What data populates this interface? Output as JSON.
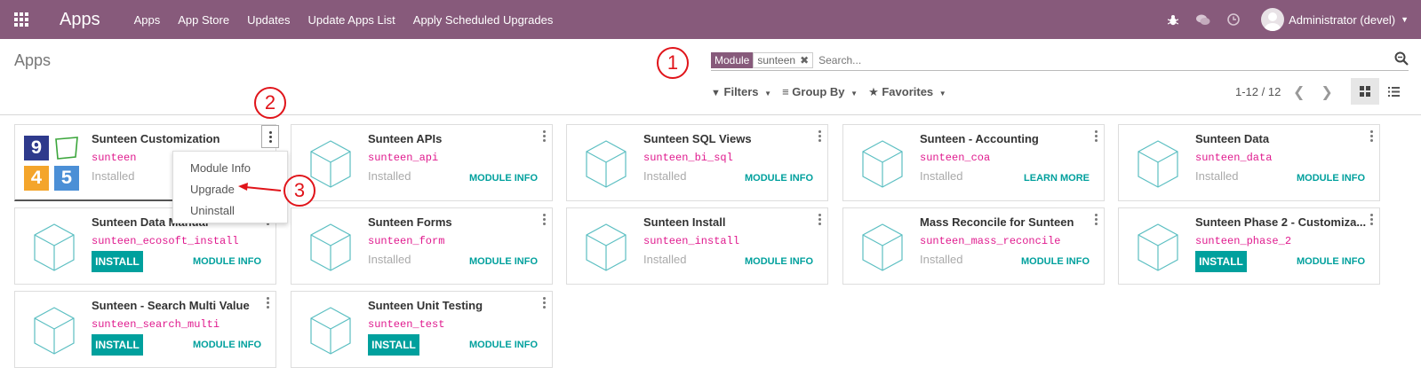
{
  "navbar": {
    "brand": "Apps",
    "menu": [
      "Apps",
      "App Store",
      "Updates",
      "Update Apps List",
      "Apply Scheduled Upgrades"
    ],
    "user": "Administrator (devel)",
    "bg_color": "#875a7b"
  },
  "control_panel": {
    "breadcrumb": "Apps",
    "search": {
      "facet_label": "Module",
      "facet_value": "sunteen",
      "placeholder": "Search..."
    },
    "filters_label": "Filters",
    "groupby_label": "Group By",
    "favorites_label": "Favorites",
    "pager": "1-12 / 12"
  },
  "cards": [
    {
      "title": "Sunteen Customization",
      "tech": "sunteen",
      "status": "Installed",
      "action": "",
      "info": ""
    },
    {
      "title": "Sunteen APIs",
      "tech": "sunteen_api",
      "status": "Installed",
      "action": "",
      "info": "MODULE INFO"
    },
    {
      "title": "Sunteen SQL Views",
      "tech": "sunteen_bi_sql",
      "status": "Installed",
      "action": "",
      "info": "MODULE INFO"
    },
    {
      "title": "Sunteen - Accounting",
      "tech": "sunteen_coa",
      "status": "Installed",
      "action": "",
      "info": "LEARN MORE"
    },
    {
      "title": "Sunteen Data",
      "tech": "sunteen_data",
      "status": "Installed",
      "action": "",
      "info": "MODULE INFO"
    },
    {
      "title": "Sunteen Data Manual",
      "tech": "sunteen_ecosoft_install",
      "status": "",
      "action": "INSTALL",
      "info": "MODULE INFO"
    },
    {
      "title": "Sunteen Forms",
      "tech": "sunteen_form",
      "status": "Installed",
      "action": "",
      "info": "MODULE INFO"
    },
    {
      "title": "Sunteen Install",
      "tech": "sunteen_install",
      "status": "Installed",
      "action": "",
      "info": "MODULE INFO"
    },
    {
      "title": "Mass Reconcile for Sunteen",
      "tech": "sunteen_mass_reconcile",
      "status": "Installed",
      "action": "",
      "info": "MODULE INFO"
    },
    {
      "title": "Sunteen Phase 2 - Customiza...",
      "tech": "sunteen_phase_2",
      "status": "",
      "action": "INSTALL",
      "info": "MODULE INFO"
    },
    {
      "title": "Sunteen - Search Multi Value",
      "tech": "sunteen_search_multi",
      "status": "",
      "action": "INSTALL",
      "info": "MODULE INFO"
    },
    {
      "title": "Sunteen Unit Testing",
      "tech": "sunteen_test",
      "status": "",
      "action": "INSTALL",
      "info": "MODULE INFO"
    }
  ],
  "dropdown": {
    "items": [
      "Module Info",
      "Upgrade",
      "Uninstall"
    ]
  },
  "annotations": [
    "1",
    "2",
    "3"
  ],
  "first_card_logo": [
    "9",
    "4",
    "5"
  ]
}
